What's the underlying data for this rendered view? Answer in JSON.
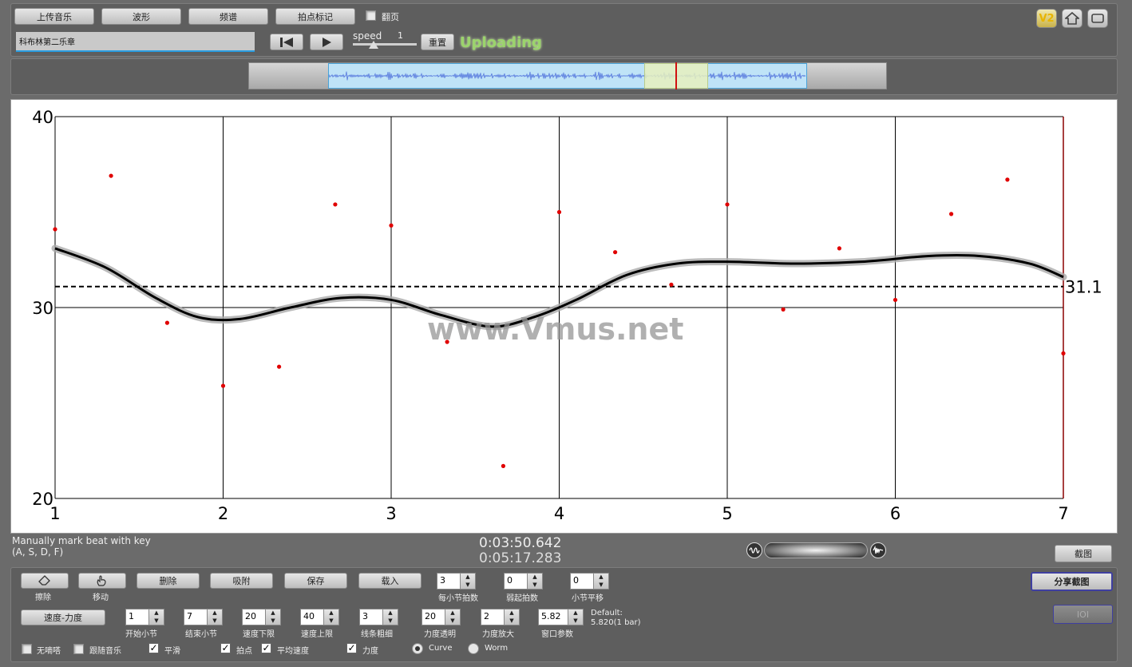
{
  "toolbar": {
    "upload": "上传音乐",
    "waveform": "波形",
    "spectrum": "频谱",
    "beat_mark": "拍点标记",
    "flip_page": "翻页",
    "reset": "重置",
    "speed_label": "speed",
    "speed_value": "1",
    "status": "Uploading",
    "version_badge": "V2"
  },
  "track": {
    "title": "科布林第二乐章"
  },
  "chart_data": {
    "type": "scatter",
    "ylim": [
      20,
      40
    ],
    "xlim": [
      1,
      7
    ],
    "yticks": [
      "20",
      "30",
      "40"
    ],
    "xticks": [
      "1",
      "2",
      "3",
      "4",
      "5",
      "6",
      "7"
    ],
    "points": [
      {
        "x": 1,
        "y": 34.1
      },
      {
        "x": 1.333,
        "y": 36.9
      },
      {
        "x": 1.667,
        "y": 29.2
      },
      {
        "x": 2,
        "y": 25.9
      },
      {
        "x": 2.333,
        "y": 26.9
      },
      {
        "x": 2.667,
        "y": 35.4
      },
      {
        "x": 3,
        "y": 34.3
      },
      {
        "x": 3.333,
        "y": 28.2
      },
      {
        "x": 3.667,
        "y": 21.7
      },
      {
        "x": 4,
        "y": 35
      },
      {
        "x": 4.333,
        "y": 32.9
      },
      {
        "x": 4.667,
        "y": 31.2
      },
      {
        "x": 5,
        "y": 35.4
      },
      {
        "x": 5.333,
        "y": 29.9
      },
      {
        "x": 5.667,
        "y": 33.1
      },
      {
        "x": 6,
        "y": 30.4
      },
      {
        "x": 6.333,
        "y": 34.9
      },
      {
        "x": 6.667,
        "y": 36.7
      },
      {
        "x": 7,
        "y": 27.6
      }
    ],
    "curve": [
      {
        "x": 1,
        "y": 33.1
      },
      {
        "x": 1.3,
        "y": 32.1
      },
      {
        "x": 1.6,
        "y": 30.5
      },
      {
        "x": 1.85,
        "y": 29.5
      },
      {
        "x": 2.1,
        "y": 29.4
      },
      {
        "x": 2.4,
        "y": 30
      },
      {
        "x": 2.7,
        "y": 30.5
      },
      {
        "x": 3,
        "y": 30.4
      },
      {
        "x": 3.3,
        "y": 29.6
      },
      {
        "x": 3.6,
        "y": 29
      },
      {
        "x": 3.85,
        "y": 29.5
      },
      {
        "x": 4.1,
        "y": 30.4
      },
      {
        "x": 4.4,
        "y": 31.7
      },
      {
        "x": 4.7,
        "y": 32.3
      },
      {
        "x": 5,
        "y": 32.4
      },
      {
        "x": 5.4,
        "y": 32.3
      },
      {
        "x": 5.8,
        "y": 32.4
      },
      {
        "x": 6.2,
        "y": 32.7
      },
      {
        "x": 6.5,
        "y": 32.7
      },
      {
        "x": 6.8,
        "y": 32.3
      },
      {
        "x": 7,
        "y": 31.6
      }
    ],
    "mean_value": 31.1,
    "mean_label": "31.1"
  },
  "watermark": "www.Vmus.net",
  "info": {
    "hint_line1": "Manually mark beat with key",
    "hint_line2": "(A, S, D, F)",
    "current_time": "0:03:50.642",
    "total_time": "0:05:17.283",
    "screenshot": "截图",
    "share_screenshot": "分享截图",
    "ioi": "IOI"
  },
  "controls": {
    "erase": "擦除",
    "move": "移动",
    "delete": "删除",
    "snap": "吸附",
    "save": "保存",
    "load": "载入",
    "tempo_dynamics": "速度-力度",
    "beats_per_bar_label": "每小节拍数",
    "beats_per_bar": "3",
    "pickup_label": "弱起拍数",
    "pickup": "0",
    "bar_shift_label": "小节平移",
    "bar_shift": "0",
    "start_bar_label": "开始小节",
    "start_bar": "1",
    "end_bar_label": "结束小节",
    "end_bar": "7",
    "tempo_min_label": "速度下限",
    "tempo_min": "20",
    "tempo_max_label": "速度上限",
    "tempo_max": "40",
    "line_width_label": "线条粗细",
    "line_width": "3",
    "dyn_opacity_label": "力度透明",
    "dyn_opacity": "20",
    "dyn_zoom_label": "力度放大",
    "dyn_zoom": "2",
    "window_label": "窗口参数",
    "window": "5.82",
    "default_line1": "Default:",
    "default_line2": "5.820(1 bar)",
    "no_metronome": "无嘀嗒",
    "follow_music": "跟随音乐",
    "smooth": "平滑",
    "beats": "拍点",
    "avg_tempo": "平均速度",
    "dynamics": "力度",
    "curve": "Curve",
    "worm": "Worm"
  }
}
